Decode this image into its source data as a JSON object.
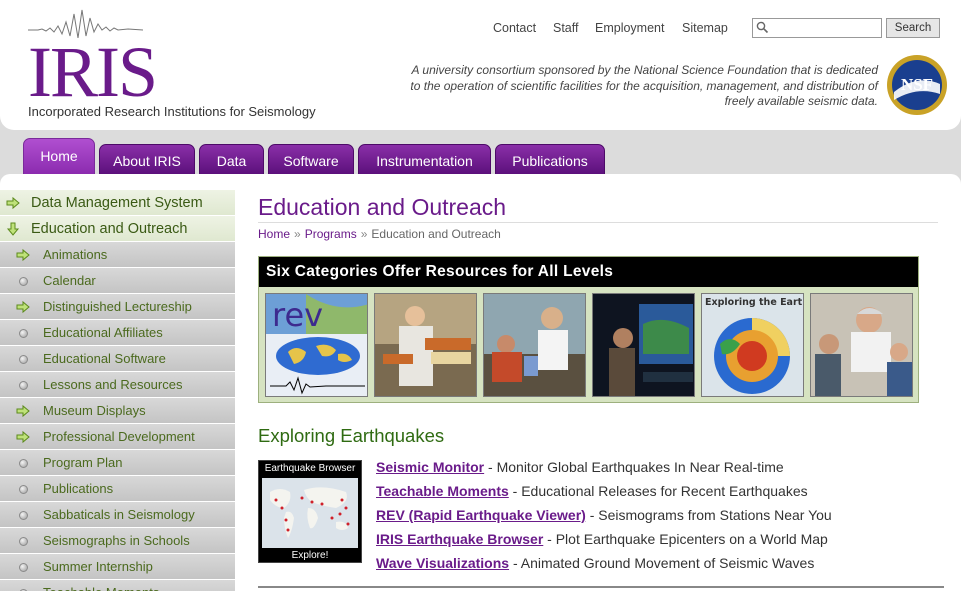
{
  "header": {
    "logo_text": "IRIS",
    "logo_subtitle": "Incorporated Research Institutions for Seismology",
    "top_links": [
      "Contact",
      "Staff",
      "Employment",
      "Sitemap"
    ],
    "search": {
      "placeholder": "",
      "value": "",
      "button_label": "Search"
    },
    "tagline": "A university consortium sponsored by the National Science Foundation that is dedicated to the operation of scientific facilities for the acquisition, management, and distribution of freely available seismic data.",
    "nsf_logo_text": "NSF"
  },
  "nav": {
    "tabs": [
      {
        "label": "Home",
        "active": true
      },
      {
        "label": "About IRIS",
        "active": false
      },
      {
        "label": "Data",
        "active": false
      },
      {
        "label": "Software",
        "active": false
      },
      {
        "label": "Instrumentation",
        "active": false
      },
      {
        "label": "Publications",
        "active": false
      }
    ]
  },
  "sidebar": {
    "top_items": [
      {
        "label": "Data Management System",
        "icon": "arrow-right-icon"
      },
      {
        "label": "Education and Outreach",
        "icon": "arrow-down-icon"
      }
    ],
    "sub_items": [
      {
        "label": "Animations",
        "icon": "arrow-right-icon"
      },
      {
        "label": "Calendar",
        "icon": "bullet-icon"
      },
      {
        "label": "Distinguished Lectureship",
        "icon": "arrow-right-icon"
      },
      {
        "label": "Educational Affiliates",
        "icon": "bullet-icon"
      },
      {
        "label": "Educational Software",
        "icon": "bullet-icon"
      },
      {
        "label": "Lessons and Resources",
        "icon": "bullet-icon"
      },
      {
        "label": "Museum Displays",
        "icon": "arrow-right-icon"
      },
      {
        "label": "Professional Development",
        "icon": "arrow-right-icon"
      },
      {
        "label": "Program Plan",
        "icon": "bullet-icon"
      },
      {
        "label": "Publications",
        "icon": "bullet-icon"
      },
      {
        "label": "Sabbaticals in Seismology",
        "icon": "bullet-icon"
      },
      {
        "label": "Seismographs in Schools",
        "icon": "bullet-icon"
      },
      {
        "label": "Summer Internship",
        "icon": "bullet-icon"
      },
      {
        "label": "Teachable Moments",
        "icon": "bullet-icon"
      }
    ]
  },
  "main": {
    "title": "Education and Outreach",
    "breadcrumb": {
      "home": "Home",
      "sep": "»",
      "programs": "Programs",
      "current": "Education and Outreach"
    },
    "categories": {
      "header": "Six Categories Offer Resources for All Levels",
      "thumb_rev_text": "rev",
      "thumb_earth_text": "Exploring the Earth"
    },
    "section_title": "Exploring Earthquakes",
    "eb_thumb": {
      "top": "Earthquake Browser",
      "bottom": "Explore!"
    },
    "links": [
      {
        "link": "Seismic Monitor",
        "desc": " - Monitor Global Earthquakes In Near Real-time"
      },
      {
        "link": "Teachable Moments",
        "desc": " - Educational Releases for Recent Earthquakes"
      },
      {
        "link": "REV (Rapid Earthquake Viewer)",
        "desc": " - Seismograms from Stations Near You"
      },
      {
        "link": "IRIS Earthquake Browser",
        "desc": " - Plot Earthquake Epicenters on a World Map"
      },
      {
        "link": "Wave Visualizations",
        "desc": " - Animated Ground Movement of Seismic Waves"
      }
    ]
  },
  "colors": {
    "brand_purple": "#6a1b8a",
    "sidebar_green": "#3a5a14",
    "section_green": "#2f6b12"
  }
}
